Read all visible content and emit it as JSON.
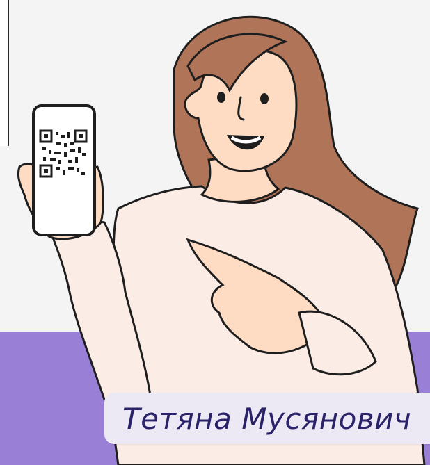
{
  "caption": {
    "author_name": "Тетяна Мусянович"
  },
  "colors": {
    "background": "#f4f4f4",
    "band": "#9a7fd6",
    "caption_bg": "#ece9f4",
    "caption_text": "#2a236a",
    "hair": "#b07458",
    "sweater": "#fbece6",
    "skin": "#fddcc3"
  },
  "icons": [
    "qr-code-icon",
    "smartphone-icon"
  ]
}
